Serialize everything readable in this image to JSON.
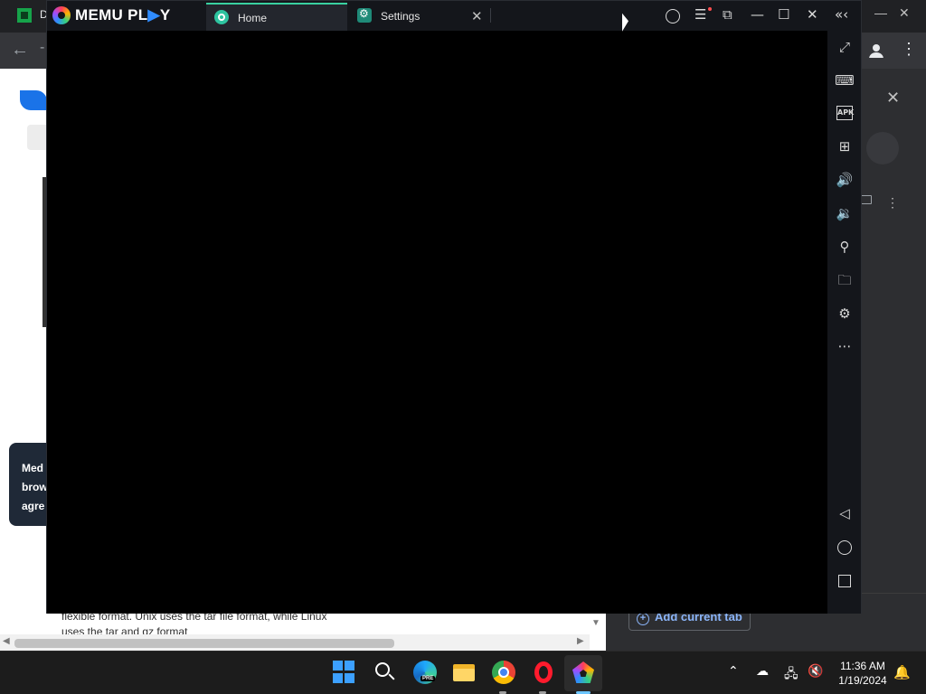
{
  "background_browser": {
    "tab_letter": "D",
    "cookie_lines": [
      "Med",
      "brow",
      "agre"
    ],
    "article_lines": [
      "flexible format. Unix uses the tar file format, while Linux",
      "uses the tar and gz format"
    ],
    "add_current_tab_label": "Add current tab",
    "close_panel_glyph": "✕",
    "minimize_glyph": "—",
    "close_glyph": "✕"
  },
  "memu": {
    "brand": "MEMU PL",
    "brand_accent": "▶",
    "brand_tail": "Y",
    "tabs": [
      {
        "label": "Home",
        "active": true
      },
      {
        "label": "Settings",
        "active": false,
        "close": "✕"
      }
    ],
    "title_buttons": {
      "menu": "☰",
      "multi_window": "⧉",
      "minimize": "—",
      "maximize": "☐",
      "close": "✕",
      "collapse": "«‹"
    },
    "sidebar": [
      {
        "name": "fullscreen-icon",
        "glyph": "⤢"
      },
      {
        "name": "keyboard-icon",
        "glyph": "⌨"
      },
      {
        "name": "apk-install-icon",
        "glyph": "APK"
      },
      {
        "name": "add-window-icon",
        "glyph": "⊞"
      },
      {
        "name": "volume-up-icon",
        "glyph": "🔊"
      },
      {
        "name": "volume-down-icon",
        "glyph": "🔉"
      },
      {
        "name": "location-icon",
        "glyph": "⚲"
      },
      {
        "name": "folder-icon",
        "glyph": "🗀"
      },
      {
        "name": "settings-icon",
        "glyph": "⚙"
      },
      {
        "name": "more-icon",
        "glyph": "⋯"
      }
    ],
    "nav": {
      "back": "◁"
    },
    "colors": {
      "accent": "#39d0a0",
      "brand_blue": "#2f8cff"
    }
  },
  "taskbar": {
    "pinned": [
      "start-icon",
      "search-icon",
      "edge-preview-icon",
      "file-explorer-icon",
      "chrome-icon",
      "opera-icon",
      "memu-icon"
    ],
    "edge_badge": "PRE",
    "tray": {
      "chevron": "⌃",
      "cloud": "☁",
      "network": "🖧",
      "volume_muted": "🔇"
    },
    "time": "11:36 AM",
    "date": "1/19/2024",
    "notification": "🔔"
  }
}
